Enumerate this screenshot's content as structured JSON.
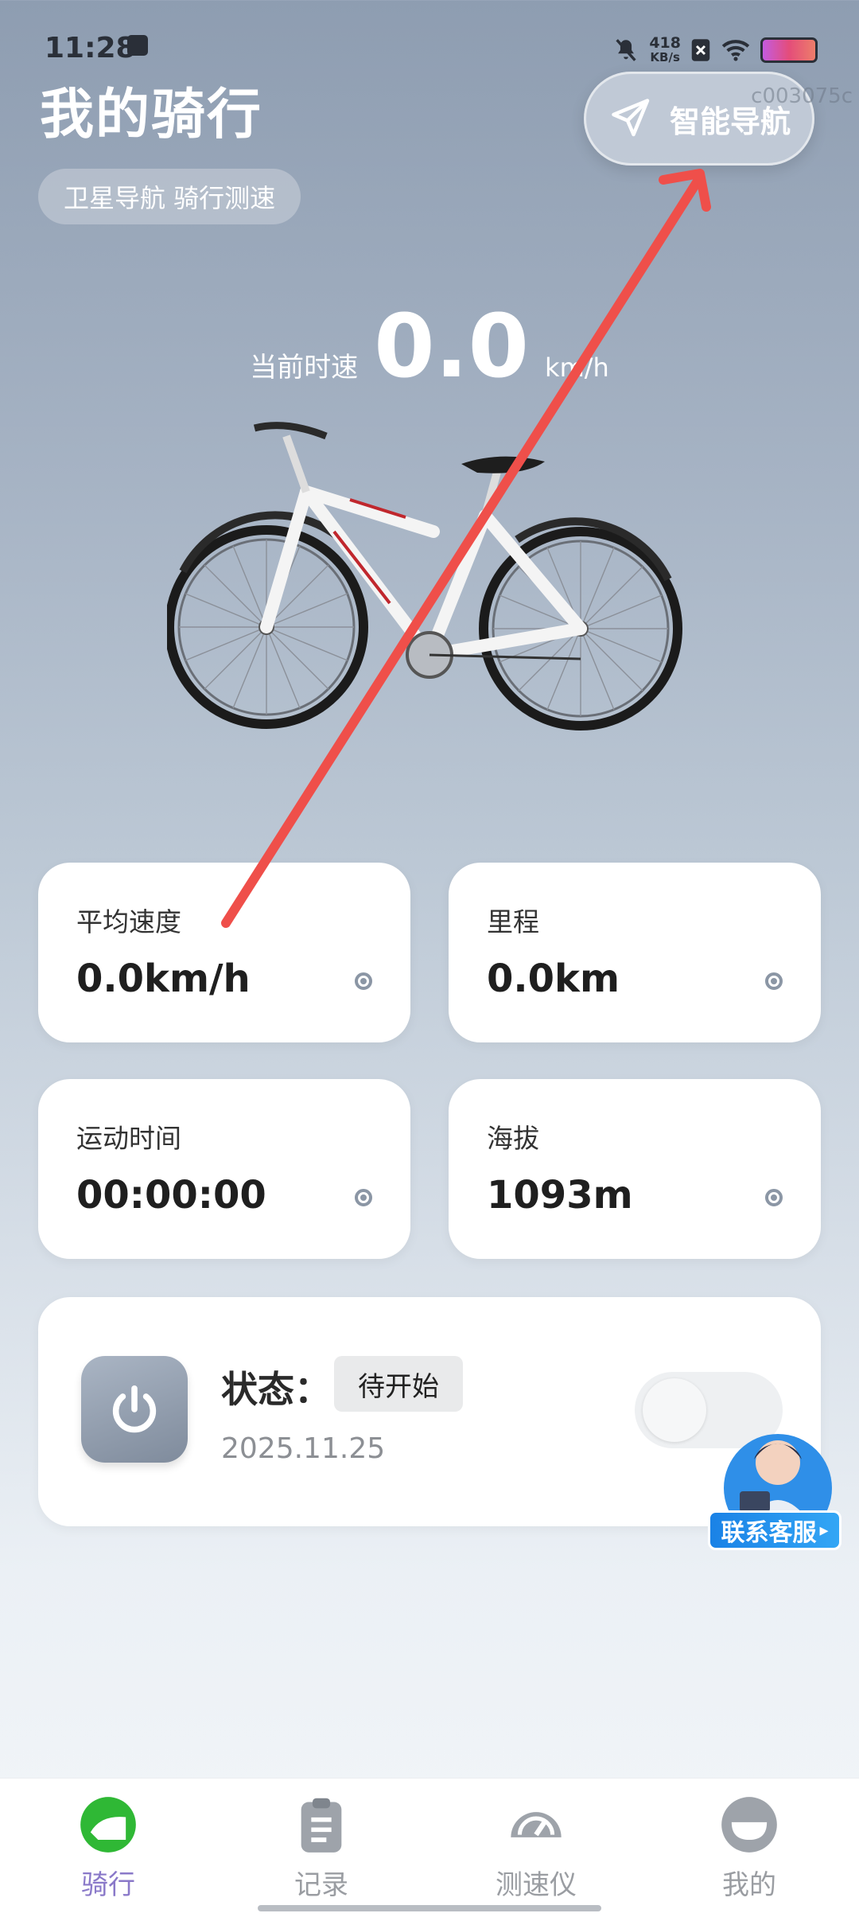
{
  "status_bar": {
    "time": "11:28",
    "net_speed_value": "418",
    "net_speed_unit": "KB/s"
  },
  "header": {
    "title": "我的骑行",
    "nav_button_label": "智能导航",
    "watermark": "c003075c",
    "feature_pill": "卫星导航 骑行测速"
  },
  "speed": {
    "label": "当前时速",
    "value": "0.0",
    "unit": "km/h"
  },
  "stats": [
    {
      "label": "平均速度",
      "value": "0.0km/h"
    },
    {
      "label": "里程",
      "value": "0.0km"
    },
    {
      "label": "运动时间",
      "value": "00:00:00"
    },
    {
      "label": "海拔",
      "value": "1093m"
    }
  ],
  "status_card": {
    "state_label": "状态：",
    "state_value": "待开始",
    "date": "2025.11.25",
    "toggle_on": false
  },
  "customer_service": {
    "label": "联系客服"
  },
  "bottom_nav": [
    {
      "label": "骑行",
      "icon": "ride-icon",
      "active": true
    },
    {
      "label": "记录",
      "icon": "clipboard-icon",
      "active": false
    },
    {
      "label": "测速仪",
      "icon": "speedometer-icon",
      "active": false
    },
    {
      "label": "我的",
      "icon": "profile-icon",
      "active": false
    }
  ],
  "colors": {
    "accent_green": "#2fb835",
    "active_nav": "#8a79c9",
    "annotation_arrow": "#ef4f4a"
  }
}
